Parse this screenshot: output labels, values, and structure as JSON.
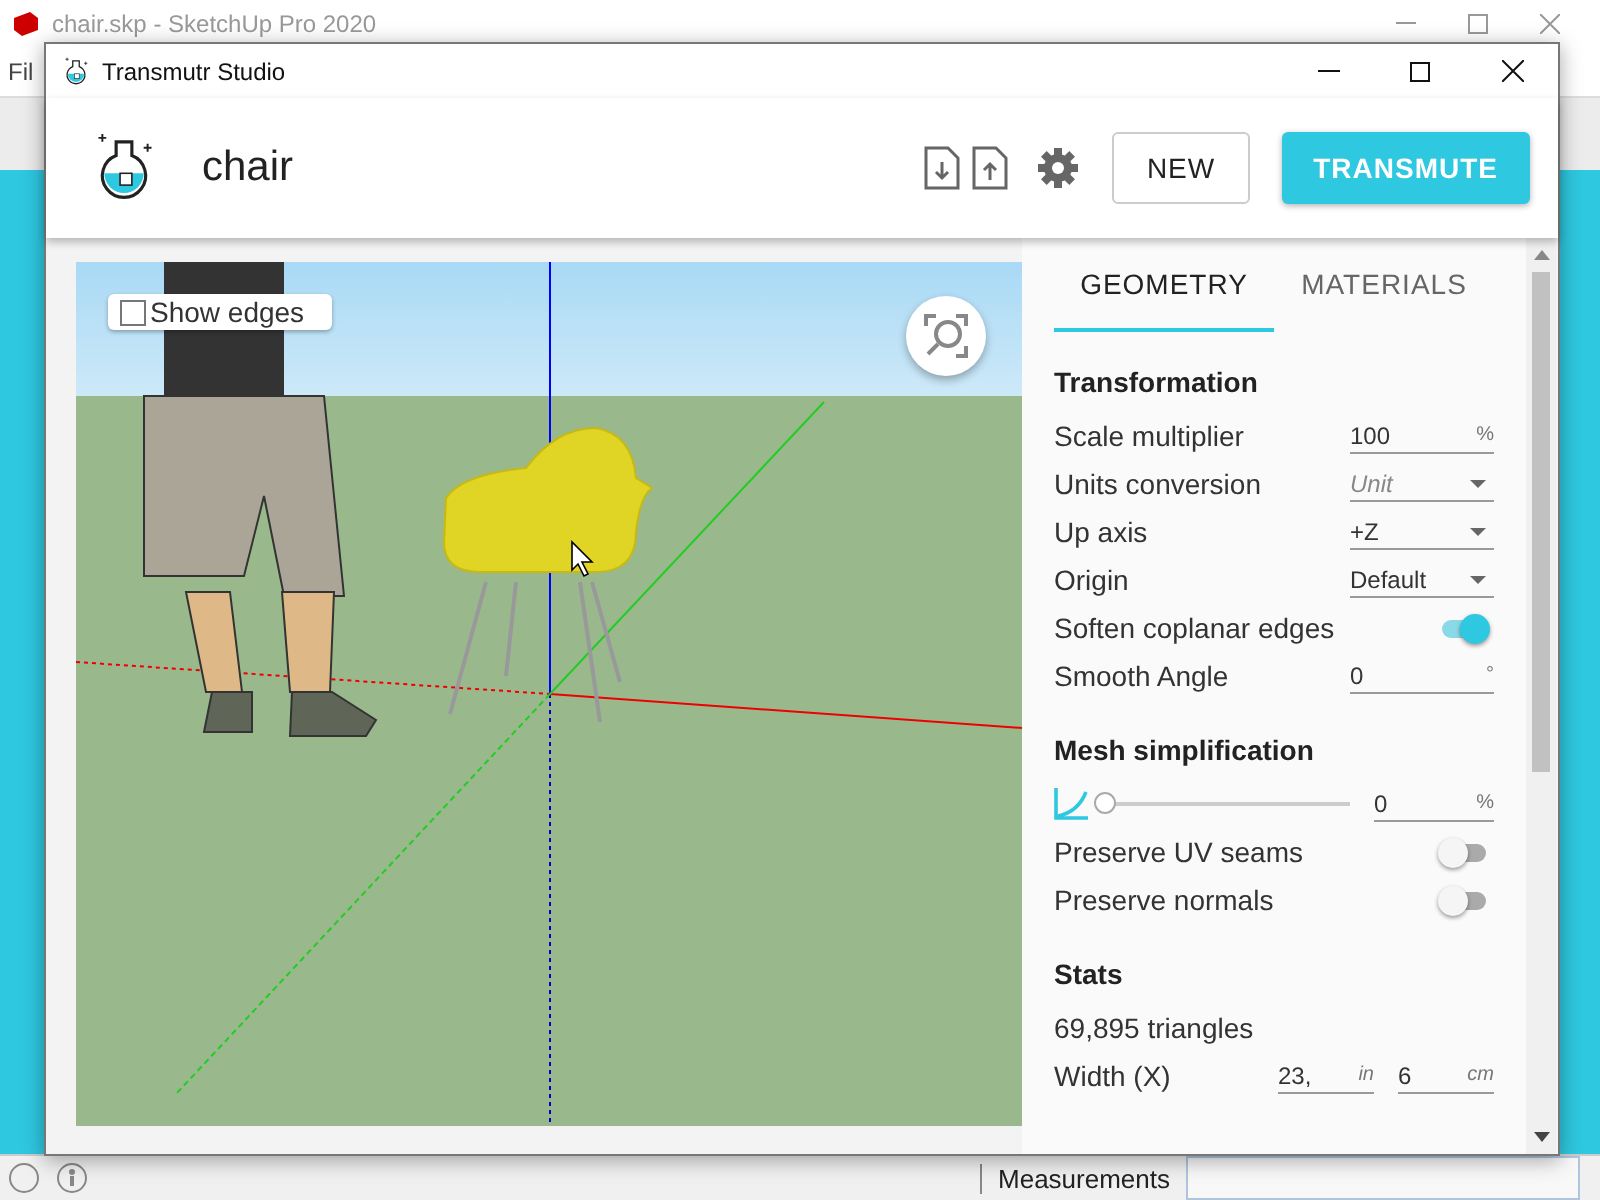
{
  "app_window": {
    "title": "chair.skp - SketchUp Pro 2020",
    "menu": [
      "Fil"
    ],
    "status_bar": {
      "label": "Measurements"
    }
  },
  "dialog": {
    "title": "Transmutr Studio",
    "header": {
      "filename": "chair",
      "buttons": [
        {
          "label": "NEW",
          "kind": "outline"
        },
        {
          "label": "TRANSMUTE",
          "kind": "primary"
        }
      ]
    },
    "viewport": {
      "show_edges": {
        "label": "Show edges",
        "checked": false
      }
    },
    "tabs": [
      {
        "label": "GEOMETRY",
        "selected": true
      },
      {
        "label": "MATERIALS",
        "selected": false
      }
    ],
    "sections": [
      {
        "title": "Transformation",
        "rows": [
          {
            "kind": "input",
            "label": "Scale multiplier",
            "value": "100",
            "unit": "%"
          },
          {
            "kind": "select",
            "label": "Units conversion",
            "placeholder": "Unit"
          },
          {
            "kind": "select",
            "label": "Up axis",
            "value": "+Z"
          },
          {
            "kind": "select",
            "label": "Origin",
            "value": "Default"
          },
          {
            "kind": "toggle",
            "label": "Soften coplanar edges",
            "on": true
          },
          {
            "kind": "input",
            "label": "Smooth Angle",
            "value": "0",
            "unit": "°"
          }
        ]
      },
      {
        "title": "Mesh simplification",
        "rows": [
          {
            "kind": "slider",
            "level": 0,
            "value": "0",
            "unit": "%"
          },
          {
            "kind": "toggle",
            "label": "Preserve UV seams",
            "on": false
          },
          {
            "kind": "toggle",
            "label": "Preserve normals",
            "on": false
          }
        ]
      },
      {
        "title": "Stats",
        "rows": [
          {
            "kind": "text",
            "label": "69,895 triangles"
          },
          {
            "kind": "dimension",
            "label": "Width (X)",
            "fields": [
              {
                "value": "23,",
                "unit": "in"
              },
              {
                "value": "6",
                "unit": "cm"
              }
            ]
          }
        ]
      }
    ]
  }
}
